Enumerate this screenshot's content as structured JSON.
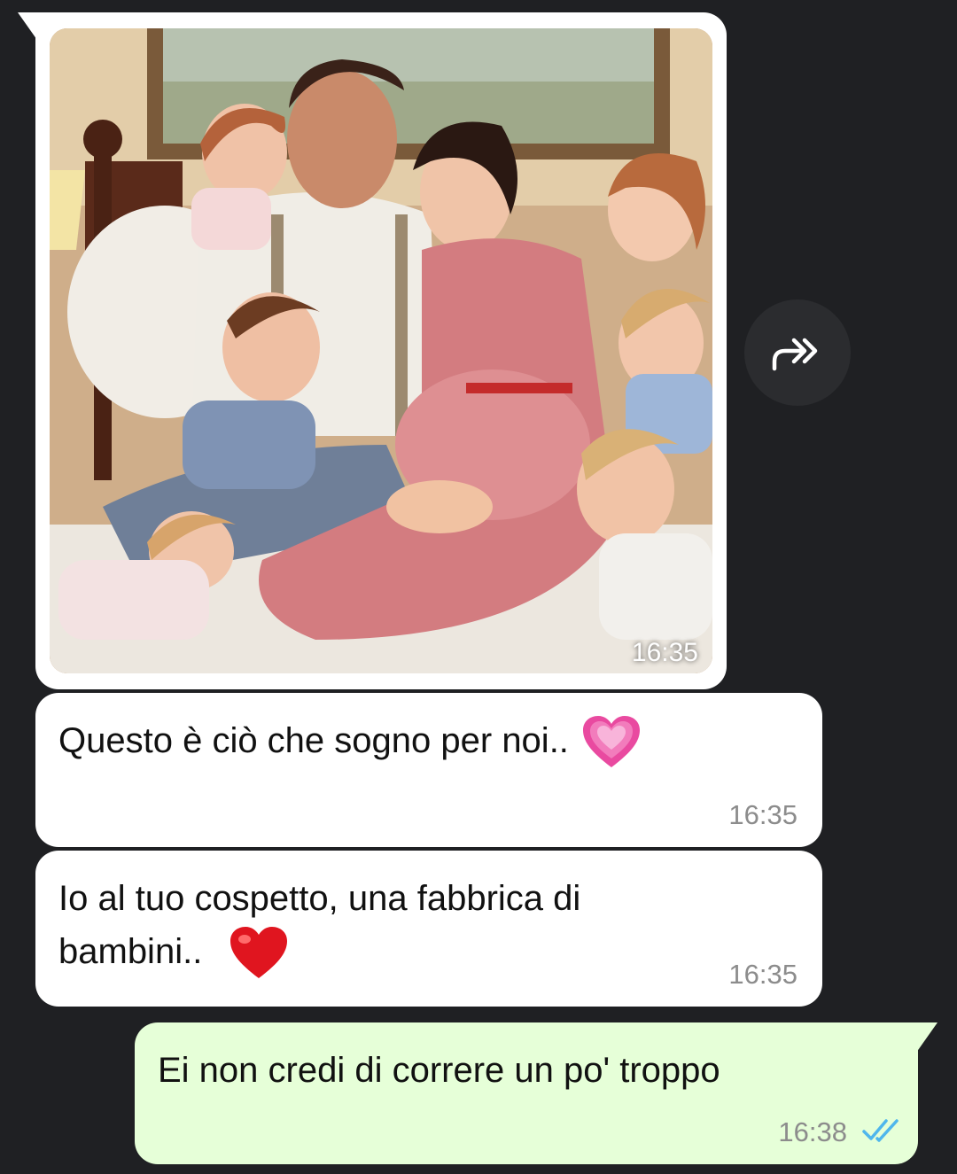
{
  "image_message": {
    "time": "16:35"
  },
  "messages": [
    {
      "direction": "incoming",
      "text": "Questo è ciò che sogno per noi..",
      "emoji": "growing-heart",
      "time": "16:35"
    },
    {
      "direction": "incoming",
      "text_line1": "Io al tuo cospetto, una fabbrica di",
      "text_line2": "bambini..",
      "emoji": "red-heart",
      "time": "16:35"
    },
    {
      "direction": "outgoing",
      "text": "Ei non credi di correre un po' troppo",
      "time": "16:38",
      "status": "read"
    }
  ],
  "colors": {
    "background": "#1f2023",
    "incoming_bubble": "#ffffff",
    "outgoing_bubble": "#e6ffd8",
    "read_ticks": "#4fb6ec",
    "timestamp": "#8c8c8c"
  },
  "icons": {
    "forward": "forward-icon",
    "read_receipt": "double-check-icon"
  }
}
